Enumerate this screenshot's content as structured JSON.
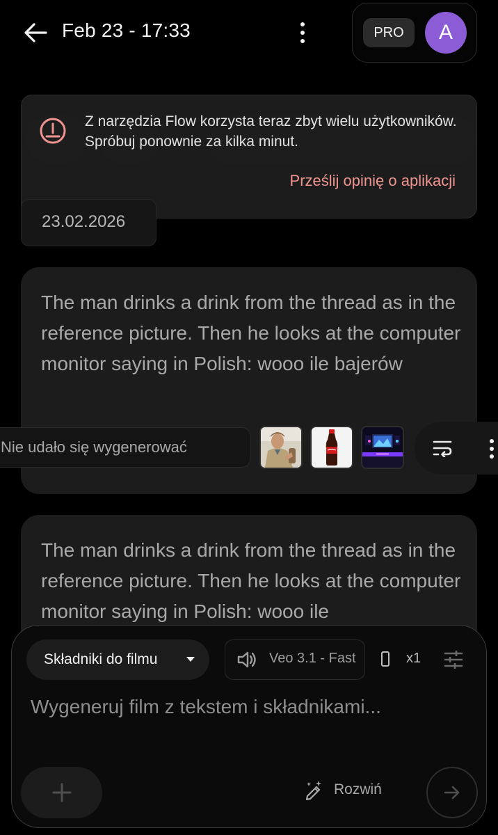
{
  "header": {
    "title": "Feb 23 - 17:33",
    "pro_badge": "PRO",
    "avatar_initial": "A",
    "avatar_color": "#8b5cd6"
  },
  "toast": {
    "message": "Z narzędzia Flow korzysta teraz zbyt wielu użytkowników. Spróbuj ponownie za kilka minut.",
    "link": "Prześlij opinię o aplikacji",
    "accent_color": "#f0948f"
  },
  "date_chip": "23.02.2026",
  "cards": [
    {
      "prompt": "The man drinks a drink from the thread as in the reference picture. Then he looks at the computer monitor saying in Polish: wooo ile bajerów",
      "status": "Nie udało się wygenerować",
      "thumbnails": [
        "man-photo",
        "cola-bottle-photo",
        "gaming-setup-photo"
      ]
    },
    {
      "prompt": "The man drinks a drink from the thread as in the reference picture. Then he looks at the computer monitor saying in Polish: wooo ile"
    }
  ],
  "composer": {
    "mode_label": "Składniki do filmu",
    "model_label": "Veo 3.1 - Fast",
    "count_label": "x1",
    "placeholder": "Wygeneruj film z tekstem i składnikami...",
    "expand_label": "Rozwiń"
  },
  "icons": {
    "back": "arrow-left-icon",
    "more": "more-vert-icon",
    "error": "error-circle-icon",
    "reuse": "wrap-text-icon",
    "audio": "volume-icon",
    "aspect": "portrait-aspect-icon",
    "settings": "tune-icon",
    "add": "plus-icon",
    "expand": "magic-pen-icon",
    "send": "arrow-right-icon"
  }
}
